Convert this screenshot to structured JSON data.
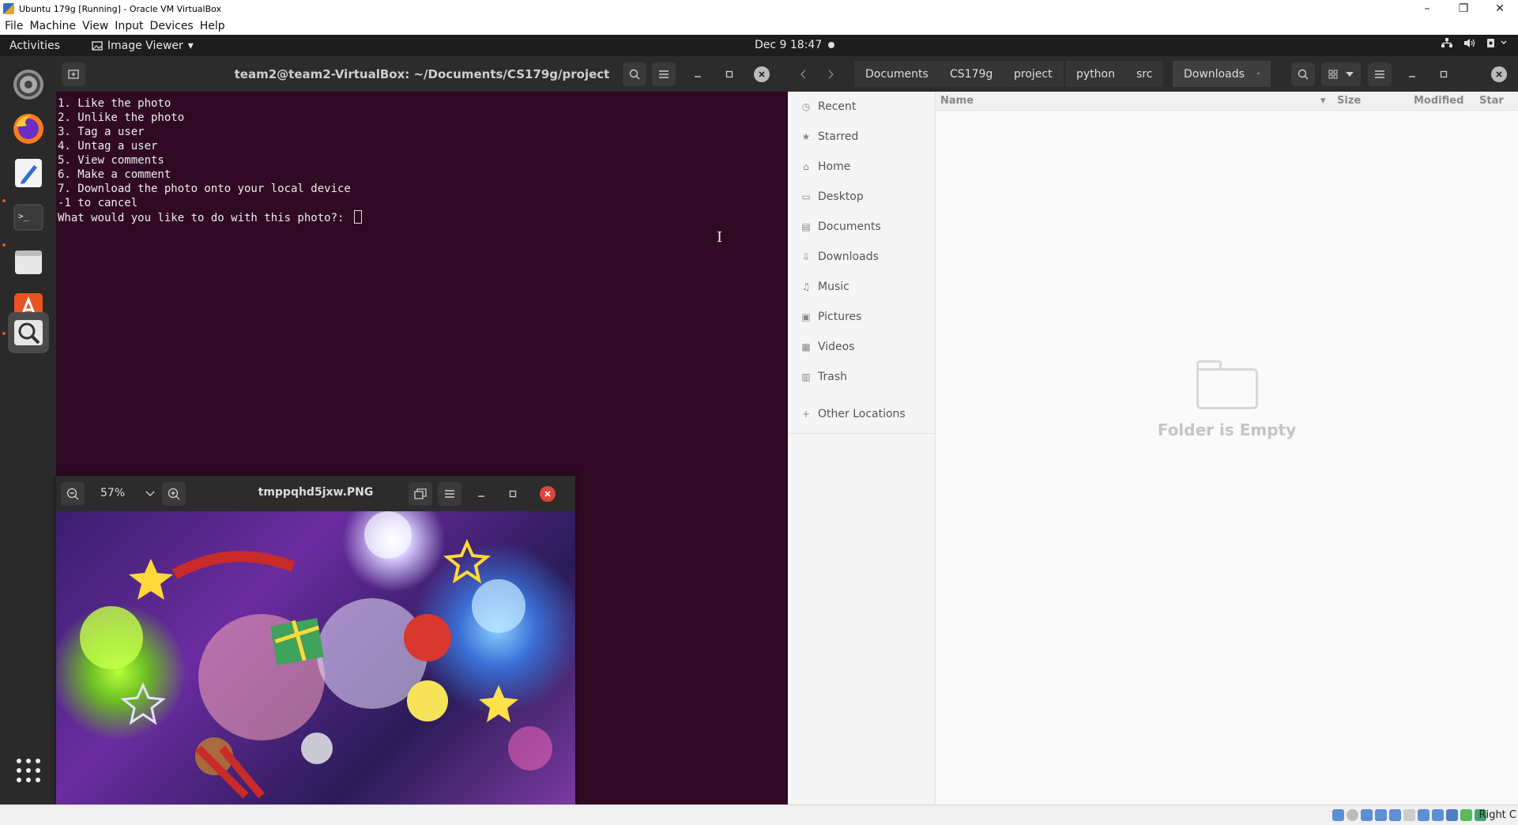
{
  "vbox": {
    "window_title": "Ubuntu 179g [Running] - Oracle VM VirtualBox",
    "menu": [
      "File",
      "Machine",
      "View",
      "Input",
      "Devices",
      "Help"
    ],
    "window_controls": {
      "minimize": "–",
      "restore": "❐",
      "close": "✕"
    },
    "host_key": "Right C"
  },
  "topbar": {
    "activities": "Activities",
    "app_menu": "Image Viewer",
    "clock": "Dec 9  18:47"
  },
  "dock": {
    "items": [
      "settings-icon",
      "firefox-icon",
      "text-editor-icon",
      "terminal-icon",
      "files-icon",
      "software-icon",
      "image-viewer-icon",
      "show-apps-icon"
    ],
    "terminal_glyph": ">_"
  },
  "terminal": {
    "title": "team2@team2-VirtualBox: ~/Documents/CS179g/project",
    "lines": [
      "1. Like the photo",
      "2. Unlike the photo",
      "3. Tag a user",
      "4. Untag a user",
      "5. View comments",
      "6. Make a comment",
      "7. Download the photo onto your local device",
      "-1 to cancel"
    ],
    "prompt": "What would you like to do with this photo?: "
  },
  "viewer": {
    "filename": "tmppqhd5jxw.PNG",
    "zoom": "57%"
  },
  "files": {
    "breadcrumbs": [
      "Documents",
      "CS179g",
      "project",
      "python",
      "src",
      "Downloads"
    ],
    "sidebar": [
      {
        "label": "Recent",
        "icon": "clock-icon",
        "glyph": "◷"
      },
      {
        "label": "Starred",
        "icon": "star-icon",
        "glyph": "★"
      },
      {
        "label": "Home",
        "icon": "home-icon",
        "glyph": "⌂"
      },
      {
        "label": "Desktop",
        "icon": "desktop-icon",
        "glyph": "▭"
      },
      {
        "label": "Documents",
        "icon": "document-icon",
        "glyph": "▤"
      },
      {
        "label": "Downloads",
        "icon": "download-icon",
        "glyph": "⇩"
      },
      {
        "label": "Music",
        "icon": "music-icon",
        "glyph": "♫"
      },
      {
        "label": "Pictures",
        "icon": "picture-icon",
        "glyph": "▣"
      },
      {
        "label": "Videos",
        "icon": "video-icon",
        "glyph": "▦"
      },
      {
        "label": "Trash",
        "icon": "trash-icon",
        "glyph": "▥"
      }
    ],
    "other_locations": "Other Locations",
    "columns": {
      "name": "Name",
      "size": "Size",
      "modified": "Modified",
      "star": "Star"
    },
    "empty_message": "Folder is Empty"
  },
  "colors": {
    "terminal_bg": "#300a24",
    "header_bg": "#2c2c2c",
    "dock_bg": "#2a2a2a",
    "accent": "#e95420",
    "close_red": "#e0443a"
  }
}
